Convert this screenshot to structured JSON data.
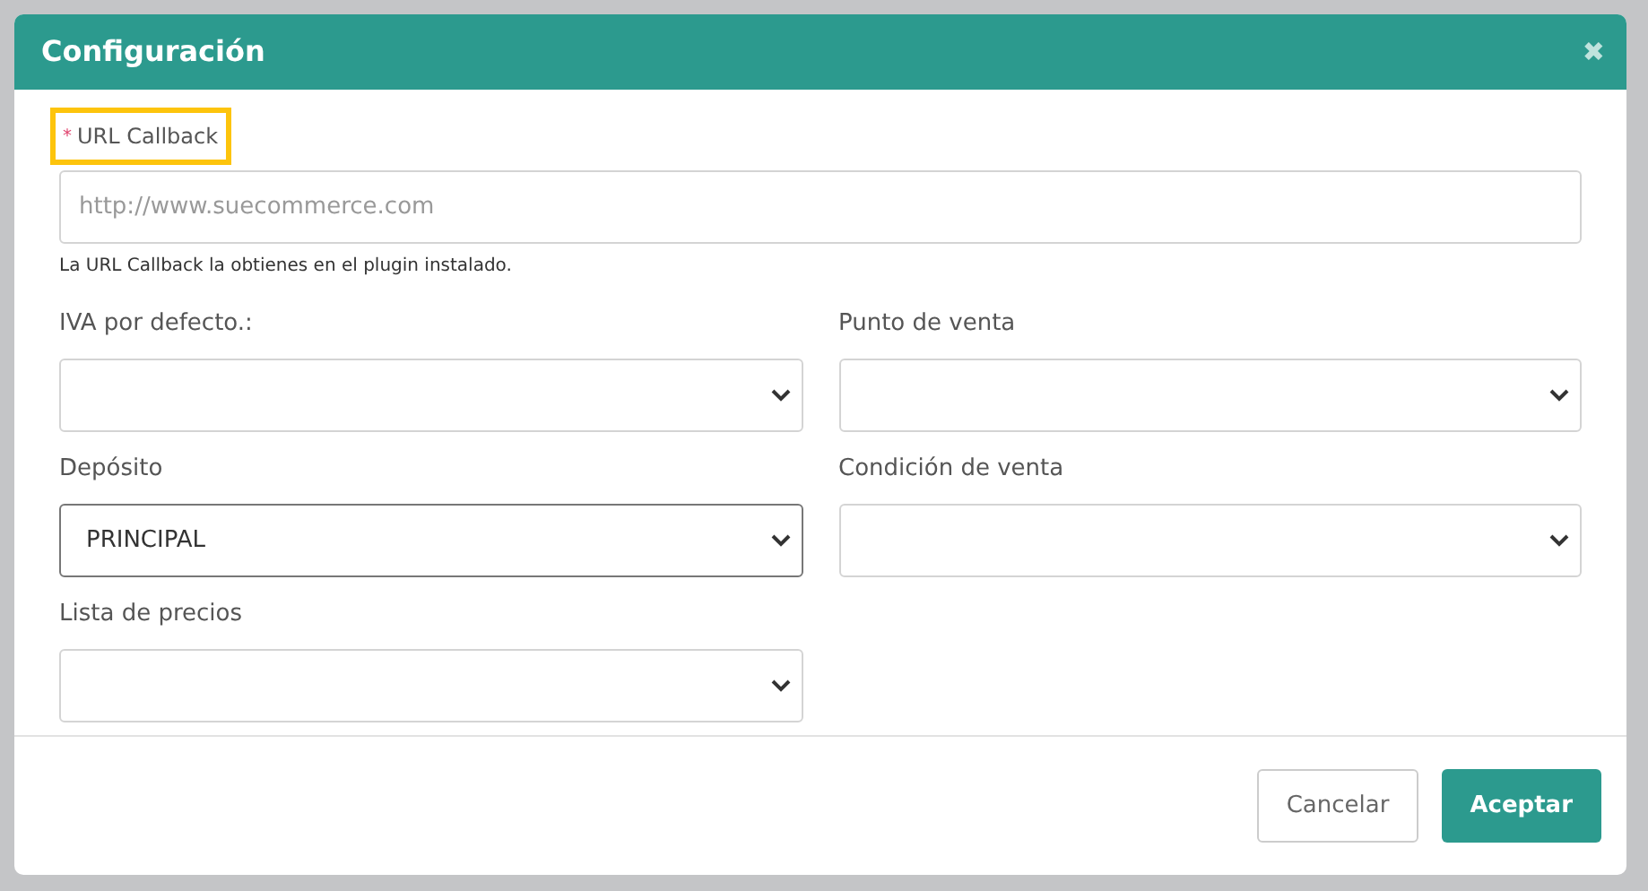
{
  "dialog": {
    "title": "Configuración",
    "close_icon": "✖"
  },
  "callback": {
    "required_mark": "*",
    "label": "URL Callback",
    "highlighted": true,
    "placeholder": "http://www.suecommerce.com",
    "help": "La URL Callback la obtienes en el plugin instalado."
  },
  "selects": [
    {
      "label": "IVA por defecto.:",
      "focused": false
    },
    {
      "label": "Punto de venta",
      "focused": false
    },
    {
      "label": "Depósito",
      "value": "PRINCIPAL",
      "focused": true
    },
    {
      "label": "Condición de venta",
      "focused": false
    },
    {
      "label": "Lista de precios",
      "focused": false
    }
  ],
  "buttons": [
    {
      "label": "Cancelar",
      "kind": "secondary"
    },
    {
      "label": "Aceptar",
      "kind": "primary"
    }
  ]
}
